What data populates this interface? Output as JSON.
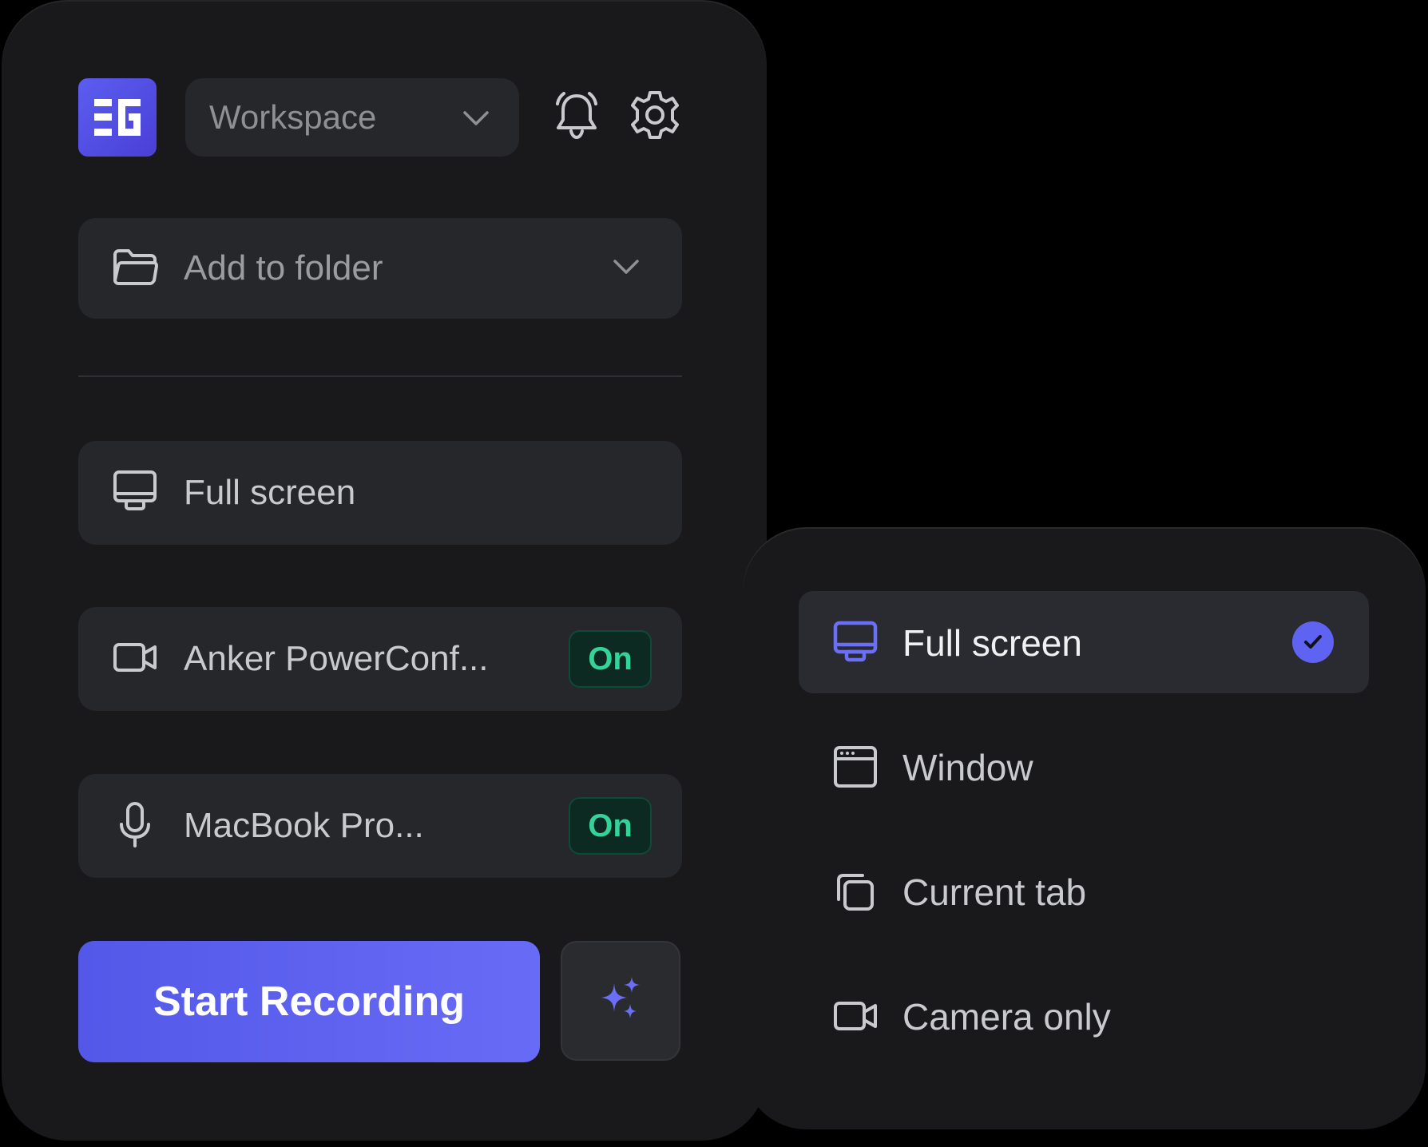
{
  "header": {
    "logo_icon": "eg-logo-icon",
    "workspace_label": "Workspace",
    "notification_icon": "bell-icon",
    "settings_icon": "gear-icon"
  },
  "folder": {
    "label": "Add to folder",
    "icon": "folder-icon"
  },
  "source": {
    "label": "Full screen",
    "icon": "monitor-icon"
  },
  "camera": {
    "label": "Anker PowerConf...",
    "status": "On",
    "icon": "video-camera-icon"
  },
  "microphone": {
    "label": "MacBook Pro...",
    "status": "On",
    "icon": "microphone-icon"
  },
  "actions": {
    "start_label": "Start Recording",
    "ai_icon": "sparkles-icon"
  },
  "dropdown": {
    "options": [
      {
        "label": "Full screen",
        "icon": "monitor-icon",
        "selected": true
      },
      {
        "label": "Window",
        "icon": "window-icon",
        "selected": false
      },
      {
        "label": "Current tab",
        "icon": "tabs-icon",
        "selected": false
      },
      {
        "label": "Camera only",
        "icon": "video-camera-icon",
        "selected": false
      }
    ]
  },
  "colors": {
    "accent": "#5f63f2",
    "panel": "#19191b",
    "row": "#26272b",
    "on_text": "#34d399",
    "on_bg": "#0d2a22"
  }
}
